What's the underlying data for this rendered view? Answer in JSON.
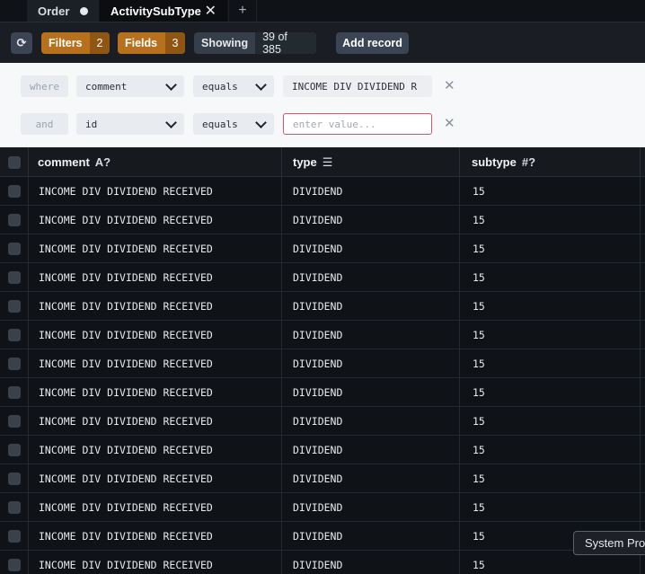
{
  "tabs": [
    {
      "label": "Order"
    },
    {
      "label": "ActivitySubType"
    },
    {
      "label": "+"
    }
  ],
  "toolbar": {
    "filters_label": "Filters",
    "filters_count": "2",
    "fields_label": "Fields",
    "fields_count": "3",
    "showing_label": "Showing",
    "showing_count": "39 of 385",
    "add_record_label": "Add record"
  },
  "filters": [
    {
      "conjunction": "where",
      "field": "comment",
      "operator": "equals",
      "value": "INCOME DIV DIVIDEND R",
      "placeholder": ""
    },
    {
      "conjunction": "and",
      "field": "id",
      "operator": "equals",
      "value": "",
      "placeholder": "enter value..."
    }
  ],
  "table": {
    "columns": [
      {
        "label": "comment",
        "badge": "A?"
      },
      {
        "label": "type",
        "badge": "☰"
      },
      {
        "label": "subtype",
        "badge": "#?"
      }
    ],
    "rows": [
      {
        "comment": "INCOME DIV DIVIDEND RECEIVED",
        "type": "DIVIDEND",
        "subtype": "15"
      },
      {
        "comment": "INCOME DIV DIVIDEND RECEIVED",
        "type": "DIVIDEND",
        "subtype": "15"
      },
      {
        "comment": "INCOME DIV DIVIDEND RECEIVED",
        "type": "DIVIDEND",
        "subtype": "15"
      },
      {
        "comment": "INCOME DIV DIVIDEND RECEIVED",
        "type": "DIVIDEND",
        "subtype": "15"
      },
      {
        "comment": "INCOME DIV DIVIDEND RECEIVED",
        "type": "DIVIDEND",
        "subtype": "15"
      },
      {
        "comment": "INCOME DIV DIVIDEND RECEIVED",
        "type": "DIVIDEND",
        "subtype": "15"
      },
      {
        "comment": "INCOME DIV DIVIDEND RECEIVED",
        "type": "DIVIDEND",
        "subtype": "15"
      },
      {
        "comment": "INCOME DIV DIVIDEND RECEIVED",
        "type": "DIVIDEND",
        "subtype": "15"
      },
      {
        "comment": "INCOME DIV DIVIDEND RECEIVED",
        "type": "DIVIDEND",
        "subtype": "15"
      },
      {
        "comment": "INCOME DIV DIVIDEND RECEIVED",
        "type": "DIVIDEND",
        "subtype": "15"
      },
      {
        "comment": "INCOME DIV DIVIDEND RECEIVED",
        "type": "DIVIDEND",
        "subtype": "15"
      },
      {
        "comment": "INCOME DIV DIVIDEND RECEIVED",
        "type": "DIVIDEND",
        "subtype": "15"
      },
      {
        "comment": "INCOME DIV DIVIDEND RECEIVED",
        "type": "DIVIDEND",
        "subtype": "15"
      },
      {
        "comment": "INCOME DIV DIVIDEND RECEIVED",
        "type": "DIVIDEND",
        "subtype": "15"
      }
    ]
  },
  "tooltip": {
    "text": "System Pro"
  },
  "colors": {
    "accent_orange": "#b7701c",
    "error_border": "#d9566a",
    "background": "#0f1216"
  }
}
